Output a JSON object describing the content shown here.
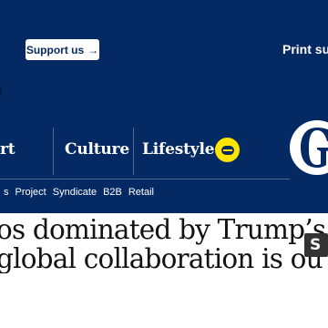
{
  "header": {
    "support_button_label": "Support us",
    "support_arrow_icon": "→",
    "print_subscription_label": "Print sub",
    "logo_name": "guardian-g-logo",
    "colors": {
      "brand_blue": "#052962",
      "brand_yellow": "#ffe500",
      "white": "#ffffff"
    }
  },
  "nav": {
    "items": [
      {
        "label": "rt"
      },
      {
        "label": "Culture"
      },
      {
        "label": "Lifestyle"
      }
    ],
    "search_icon": "search-icon"
  },
  "subnav": {
    "items": [
      {
        "label": "s"
      },
      {
        "label": "Project"
      },
      {
        "label": "Syndicate"
      },
      {
        "label": "B2B"
      },
      {
        "label": "Retail"
      }
    ]
  },
  "article": {
    "headline_line1": "os dominated by Trump’s second",
    "headline_line2": "global collaboration is out"
  }
}
